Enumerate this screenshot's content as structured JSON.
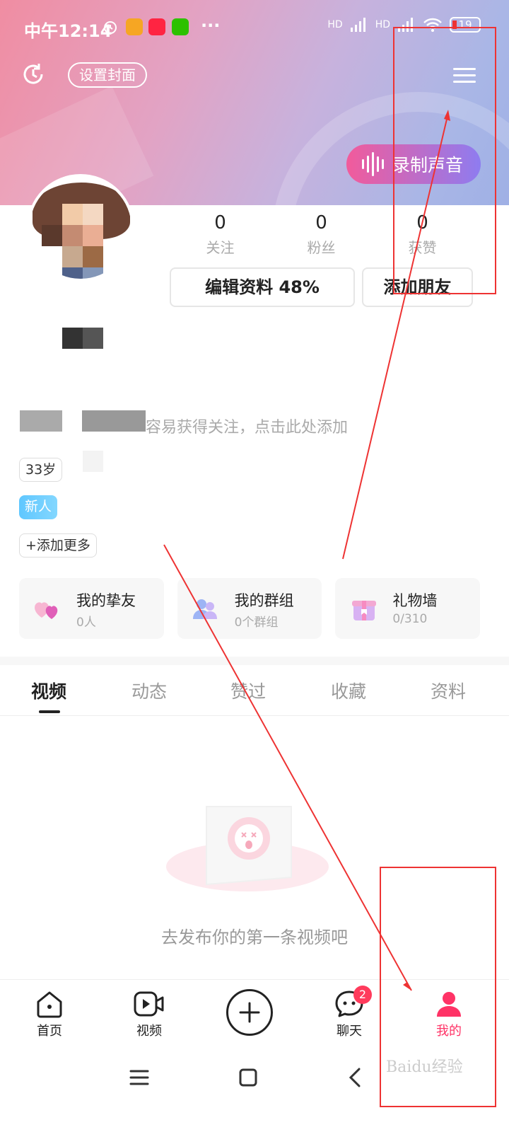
{
  "status_bar": {
    "time": "中午12:14",
    "more": "···",
    "hd1": "HD",
    "hd2": "HD",
    "battery": "19"
  },
  "header": {
    "set_cover_label": "设置封面",
    "record_voice_label": "录制声音"
  },
  "stats": [
    {
      "value": "0",
      "label": "关注"
    },
    {
      "value": "0",
      "label": "粉丝"
    },
    {
      "value": "0",
      "label": "获赞"
    }
  ],
  "actions": {
    "edit_profile_label": "编辑资料 48%",
    "add_friend_label": "添加朋友"
  },
  "profile": {
    "bio_hint": "容易获得关注，点击此处添加",
    "age_chip": "33岁",
    "new_chip": "新人",
    "add_more_label": "+添加更多"
  },
  "cards": [
    {
      "icon": "hearts-icon",
      "title": "我的挚友",
      "subtitle": "0人"
    },
    {
      "icon": "group-icon",
      "title": "我的群组",
      "subtitle": "0个群组"
    },
    {
      "icon": "gift-icon",
      "title": "礼物墙",
      "subtitle": "0/310"
    }
  ],
  "tabs": [
    "视频",
    "动态",
    "赞过",
    "收藏",
    "资料"
  ],
  "empty_state": {
    "text": "去发布你的第一条视频吧"
  },
  "bottom_nav": [
    {
      "label": "首页",
      "icon": "home-icon"
    },
    {
      "label": "视频",
      "icon": "video-icon"
    },
    {
      "label": "",
      "icon": "plus-icon"
    },
    {
      "label": "聊天",
      "icon": "chat-icon",
      "badge": "2"
    },
    {
      "label": "我的",
      "icon": "person-icon"
    }
  ],
  "colors": {
    "accent": "#ff3366",
    "annotation": "#e33333"
  },
  "watermark": "Baidu经验"
}
